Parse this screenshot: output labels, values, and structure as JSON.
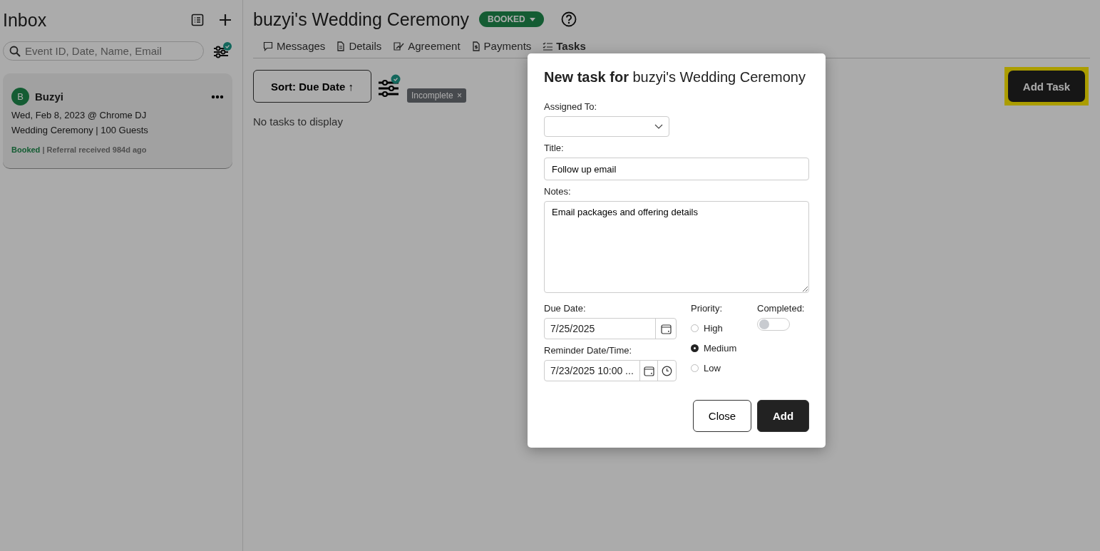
{
  "sidebar": {
    "title": "Inbox",
    "search": {
      "placeholder": "Event ID, Date, Name, Email"
    },
    "filter_active": true,
    "cards": [
      {
        "initial": "B",
        "name": "Buzyi",
        "date_line": "Wed, Feb 8, 2023 @ Chrome DJ",
        "event_line": "Wedding Ceremony | 100 Guests",
        "status": "Booked",
        "source": "| Referral received 984d ago"
      }
    ]
  },
  "header": {
    "title": "buzyi's Wedding Ceremony",
    "status_badge": "BOOKED"
  },
  "tabs": [
    {
      "label": "Messages",
      "selected": false
    },
    {
      "label": "Details",
      "selected": false
    },
    {
      "label": "Agreement",
      "selected": false
    },
    {
      "label": "Payments",
      "selected": false
    },
    {
      "label": "Tasks",
      "selected": true
    }
  ],
  "toolbar": {
    "sort_button": "Sort: Due Date ↑",
    "filter_active": true,
    "filter_chip": "Incomplete",
    "chip_close": "×",
    "add_button": "Add Task",
    "add_highlighted": true
  },
  "empty_text": "No tasks to display",
  "dialog": {
    "title": "**New task for** buzyi's Wedding Ceremony",
    "assigned_label": "Assigned To:",
    "title_label": "Title:",
    "title_value": "Follow up email",
    "notes_label": "Notes:",
    "notes_value": "Email packages and offering details",
    "due_label": "Due Date:",
    "due_value": "7/25/2025",
    "reminder_label": "Reminder Date/Time:",
    "reminder_value": "7/23/2025 10:00 ...",
    "priority_label": "Priority:",
    "priorities": [
      {
        "label": "High",
        "selected": false
      },
      {
        "label": "Medium",
        "selected": true
      },
      {
        "label": "Low",
        "selected": false
      }
    ],
    "completed_label": "Completed:",
    "completed": false,
    "buttons": [
      {
        "label": "Close",
        "kind": "secondary"
      },
      {
        "label": "Add",
        "kind": "primary"
      }
    ]
  }
}
